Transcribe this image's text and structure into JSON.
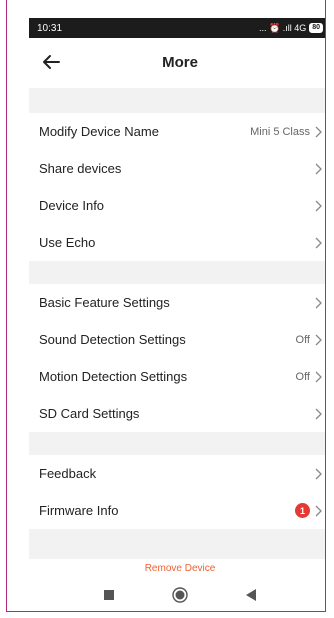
{
  "status_bar": {
    "time": "10:31",
    "indicators": "... ⏰ .ıll 4G",
    "battery": "80",
    "icons": [
      "alarm-icon",
      "signal-icon",
      "battery-icon"
    ]
  },
  "header": {
    "title": "More",
    "back_icon": "arrow-left-icon"
  },
  "section1": {
    "items": [
      {
        "label": "Modify Device Name",
        "value": "Mini 5 Class"
      },
      {
        "label": "Share devices",
        "value": ""
      },
      {
        "label": "Device Info",
        "value": ""
      },
      {
        "label": "Use Echo",
        "value": ""
      }
    ]
  },
  "section2": {
    "items": [
      {
        "label": "Basic Feature Settings",
        "value": ""
      },
      {
        "label": "Sound Detection Settings",
        "value": "Off"
      },
      {
        "label": "Motion Detection Settings",
        "value": "Off"
      },
      {
        "label": "SD Card Settings",
        "value": ""
      }
    ]
  },
  "section3": {
    "items": [
      {
        "label": "Feedback",
        "value": ""
      },
      {
        "label": "Firmware Info",
        "badge": "1"
      }
    ]
  },
  "remove_device": "Remove Device",
  "colors": {
    "accent": "#f06030",
    "badge": "#e53935",
    "frame": "#b02a78"
  }
}
